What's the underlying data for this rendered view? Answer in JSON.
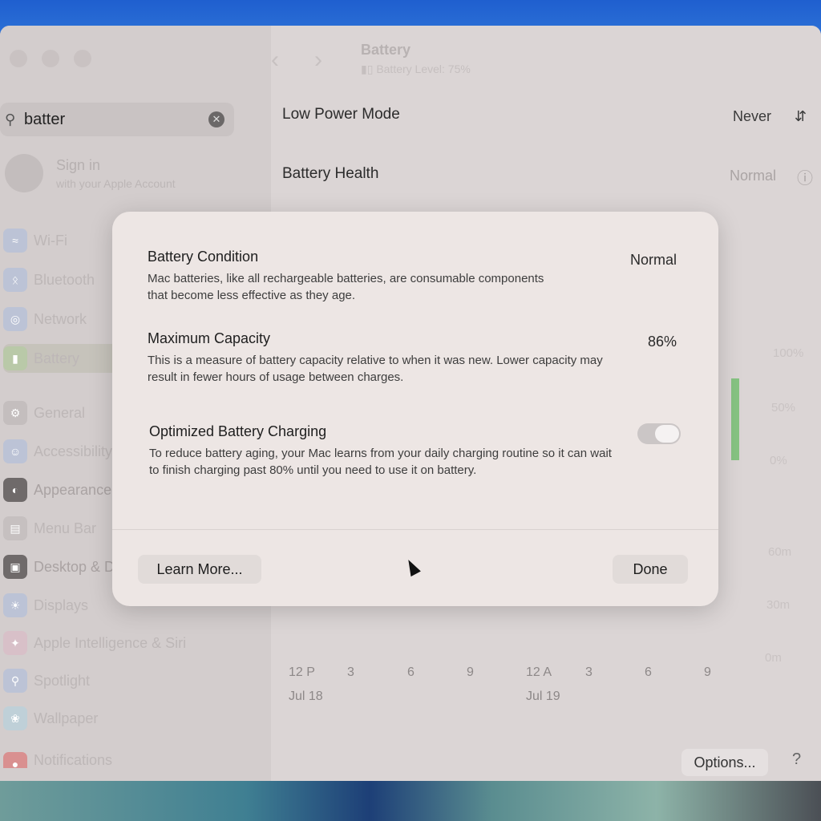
{
  "window": {
    "title": "Battery",
    "subtitle": "Battery Level: 75%"
  },
  "search": {
    "value": "batter"
  },
  "sidebar": {
    "signin_title": "Sign in",
    "signin_sub": "with your Apple Account",
    "items": [
      {
        "label": "Wi-Fi",
        "icon": "wifi-icon"
      },
      {
        "label": "Bluetooth",
        "icon": "bluetooth-icon"
      },
      {
        "label": "Network",
        "icon": "globe-icon"
      },
      {
        "label": "Battery",
        "icon": "battery-icon",
        "active": true
      },
      {
        "label": "General",
        "icon": "gear-icon"
      },
      {
        "label": "Accessibility",
        "icon": "accessibility-icon"
      },
      {
        "label": "Appearance",
        "icon": "appearance-icon"
      },
      {
        "label": "Menu Bar",
        "icon": "menubar-icon"
      },
      {
        "label": "Desktop & Dock",
        "icon": "dock-icon"
      },
      {
        "label": "Displays",
        "icon": "display-icon"
      },
      {
        "label": "Apple Intelligence & Siri",
        "icon": "siri-icon"
      },
      {
        "label": "Spotlight",
        "icon": "spotlight-icon"
      },
      {
        "label": "Wallpaper",
        "icon": "wallpaper-icon"
      },
      {
        "label": "Notifications",
        "icon": "notifications-icon"
      }
    ]
  },
  "settings": {
    "low_power_label": "Low Power Mode",
    "low_power_value": "Never",
    "battery_health_label": "Battery Health",
    "battery_health_value": "Normal"
  },
  "chart": {
    "y_level": [
      "100%",
      "50%",
      "0%"
    ],
    "y_time": [
      "60m",
      "30m",
      "0m"
    ],
    "x_ticks": [
      "12 P",
      "3",
      "6",
      "9",
      "12 A",
      "3",
      "6",
      "9"
    ],
    "dates": [
      "Jul 18",
      "Jul 19"
    ]
  },
  "footer": {
    "options": "Options...",
    "help": "?"
  },
  "modal": {
    "condition_title": "Battery Condition",
    "condition_value": "Normal",
    "condition_desc": "Mac batteries, like all rechargeable batteries, are consumable components that become less effective as they age.",
    "capacity_title": "Maximum Capacity",
    "capacity_value": "86%",
    "capacity_desc": "This is a measure of battery capacity relative to when it was new. Lower capacity may result in fewer hours of usage between charges.",
    "optimized_title": "Optimized Battery Charging",
    "optimized_desc": "To reduce battery aging, your Mac learns from your daily charging routine so it can wait to finish charging past 80% until you need to use it on battery.",
    "optimized_enabled": true,
    "learn_more": "Learn More...",
    "done": "Done"
  },
  "colors": {
    "accent_green": "#86c382",
    "modal_bg": "#ede6e4"
  }
}
